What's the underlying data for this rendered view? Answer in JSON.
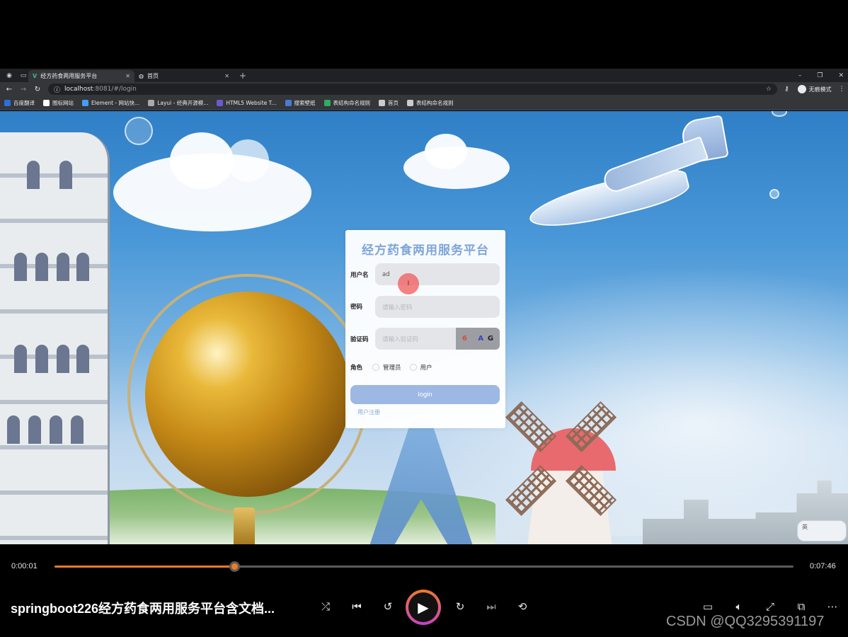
{
  "browser": {
    "tabs": [
      {
        "title": "经方药食两用服务平台",
        "active": true,
        "icon": "vue-icon"
      },
      {
        "title": "首页",
        "active": false,
        "icon": "globe-icon"
      }
    ],
    "url": {
      "host": "localhost",
      "path": ":8081/#/login"
    },
    "profile_label": "无痕模式",
    "bookmarks": [
      {
        "label": "百度翻译",
        "color": "#2a6fdb"
      },
      {
        "label": "图标网站",
        "color": "#ffffff"
      },
      {
        "label": "Element - 网站快...",
        "color": "#409eff"
      },
      {
        "label": "Layui - 经典开源模...",
        "color": "#aaaaaa"
      },
      {
        "label": "HTML5 Website T...",
        "color": "#6a5acd"
      },
      {
        "label": "搜索壁纸",
        "color": "#4a7bd1"
      },
      {
        "label": "表结构命名规则",
        "color": "#2fae5e"
      },
      {
        "label": "首页",
        "color": "#cccccc"
      },
      {
        "label": "表结构命名规则",
        "color": "#cccccc"
      }
    ]
  },
  "login": {
    "title": "经方药食两用服务平台",
    "username_label": "用户名",
    "username_value": "ad",
    "password_label": "密码",
    "password_placeholder": "请输入密码",
    "captcha_label": "验证码",
    "captcha_placeholder": "请输入验证码",
    "captcha_chars": [
      "6",
      "·",
      "A",
      "G"
    ],
    "role_label": "角色",
    "role_options": [
      "管理员",
      "用户"
    ],
    "login_button": "login",
    "register_link": "用户注册"
  },
  "player": {
    "current_time": "0:00:01",
    "total_time": "0:07:46",
    "progress": 0.243,
    "title": "springboot226经方药食两用服务平台含文档...",
    "accent_color": "#f27b1f"
  },
  "watermark": "CSDN @QQ3295391197",
  "ime_label": "英"
}
